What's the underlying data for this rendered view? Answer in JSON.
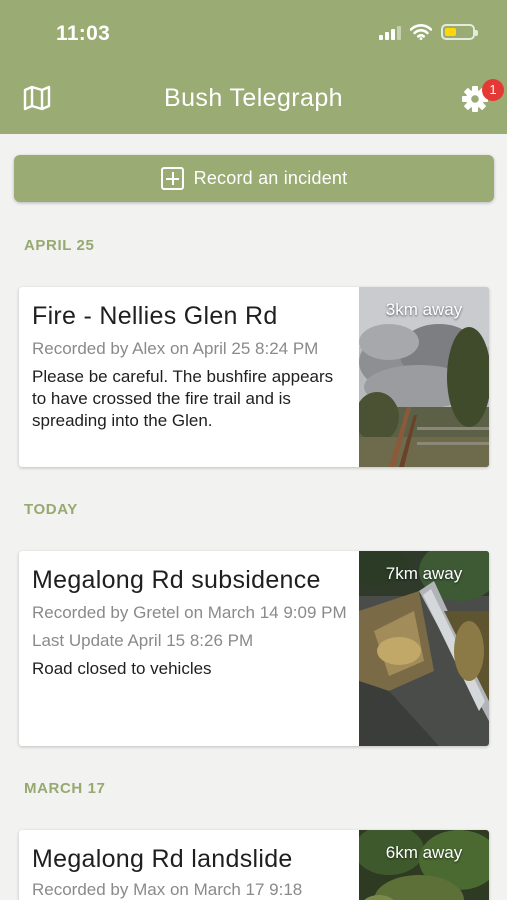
{
  "status_bar": {
    "time": "11:03"
  },
  "header": {
    "title": "Bush Telegraph",
    "badge_count": "1"
  },
  "actions": {
    "record_label": "Record an incident"
  },
  "sections": [
    {
      "label": "APRIL 25"
    },
    {
      "label": "TODAY"
    },
    {
      "label": "MARCH 17"
    }
  ],
  "incidents": [
    {
      "title": "Fire - Nellies Glen Rd",
      "recorded": "Recorded by Alex on April 25 8:24 PM",
      "description": "Please be careful.  The bushfire appears to have crossed the fire trail and is spreading into the Glen.",
      "distance": "3km away"
    },
    {
      "title": "Megalong Rd subsidence",
      "recorded": "Recorded by Gretel on March 14 9:09 PM",
      "update": "Last Update April 15 8:26 PM",
      "description": "Road closed to vehicles",
      "distance": "7km away"
    },
    {
      "title": "Megalong Rd landslide",
      "recorded": "Recorded by Max on March 17 9:18",
      "distance": "6km away"
    }
  ],
  "colors": {
    "primary": "#9aab74",
    "section": "#97a871",
    "badge": "#e53935"
  }
}
